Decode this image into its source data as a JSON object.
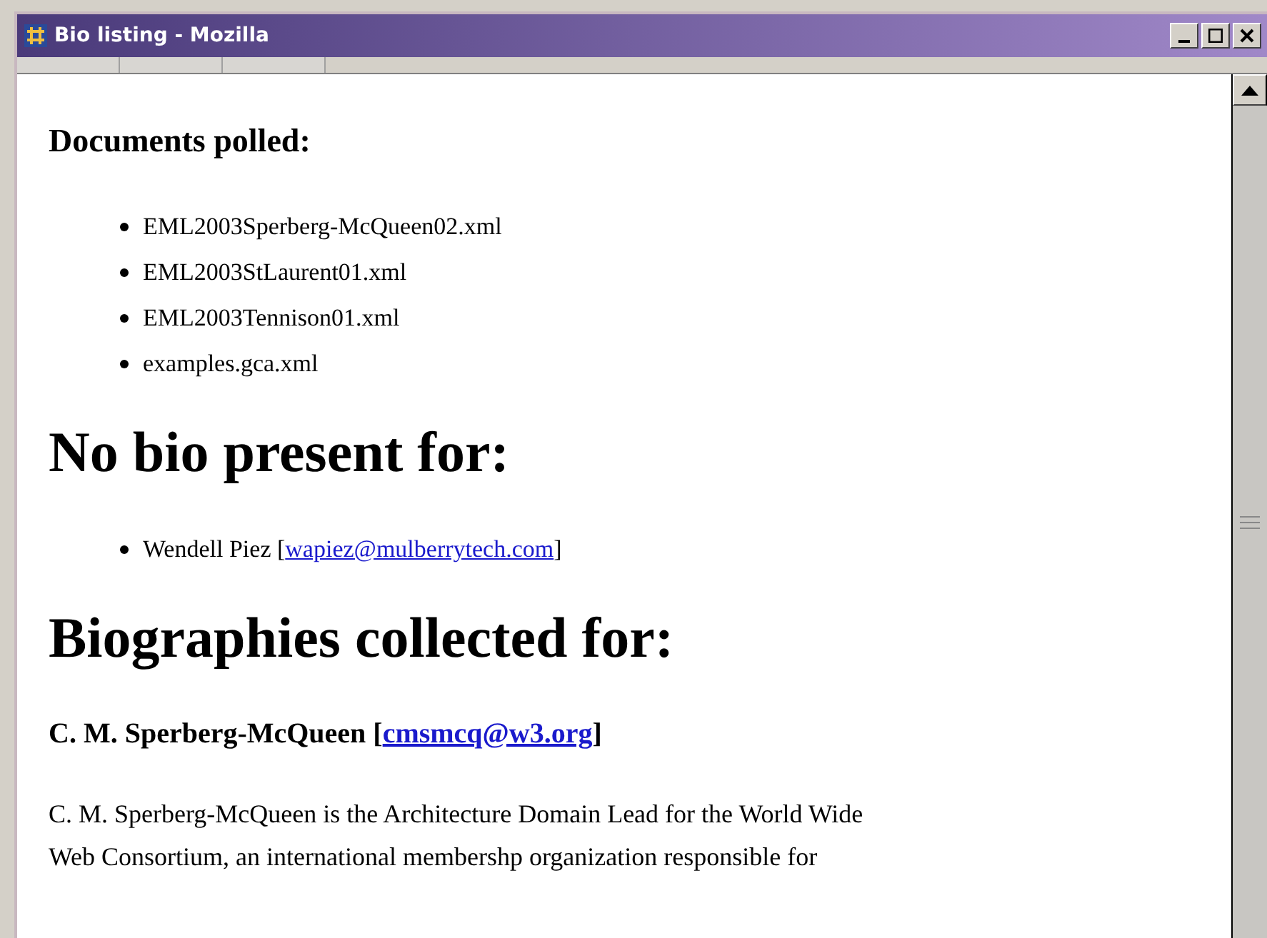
{
  "window": {
    "title": "Bio listing - Mozilla"
  },
  "sections": [
    {
      "heading": "Documents polled:",
      "kind": "subheading",
      "items": [
        {
          "text": "EML2003Sperberg-McQueen02.xml"
        },
        {
          "text": "EML2003StLaurent01.xml"
        },
        {
          "text": "EML2003Tennison01.xml"
        },
        {
          "text": "examples.gca.xml"
        }
      ]
    },
    {
      "heading": "No bio present for:",
      "kind": "heading",
      "items": [
        {
          "text": "Wendell Piez [",
          "link": "wapiez@mulberrytech.com",
          "after": "]"
        }
      ]
    },
    {
      "heading": "Biographies collected for:",
      "kind": "heading"
    }
  ],
  "bio": {
    "name": "C. M. Sperberg-McQueen [",
    "link": "cmsmcq@w3.org",
    "after": "]",
    "lines": [
      "C. M. Sperberg-McQueen is the Architecture Domain Lead for the World Wide",
      "Web Consortium, an international membershp organization responsible for"
    ]
  }
}
